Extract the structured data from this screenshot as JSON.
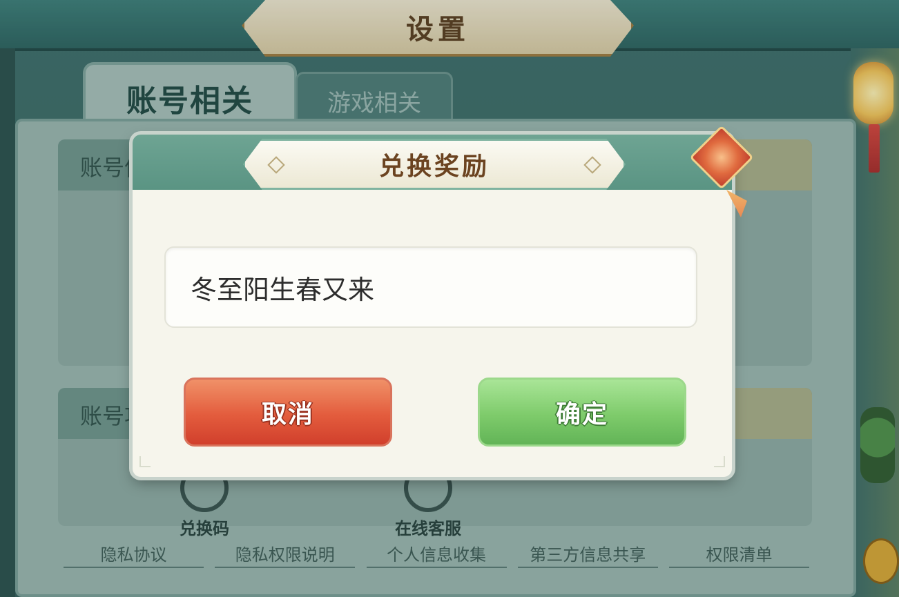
{
  "window": {
    "title": "设置"
  },
  "tabs": [
    {
      "label": "账号相关",
      "active": true
    },
    {
      "label": "游戏相关",
      "active": false
    }
  ],
  "sections": [
    {
      "label": "账号信"
    },
    {
      "label": "账号功"
    }
  ],
  "actions": {
    "redeem_label": "兑换码",
    "service_label": "在线客服"
  },
  "links": [
    "隐私协议",
    "隐私权限说明",
    "个人信息收集",
    "第三方信息共享",
    "权限清单"
  ],
  "modal": {
    "title": "兑换奖励",
    "input_value": "冬至阳生春又来",
    "cancel_label": "取消",
    "confirm_label": "确定"
  },
  "colors": {
    "header_teal": "#5a9483",
    "cancel_red": "#e35c3d",
    "confirm_green": "#7ecb6b",
    "title_brown": "#6b4320"
  },
  "icons": [
    "lantern-icon",
    "knot-ornament-icon",
    "redeem-code-icon",
    "customer-service-icon"
  ]
}
